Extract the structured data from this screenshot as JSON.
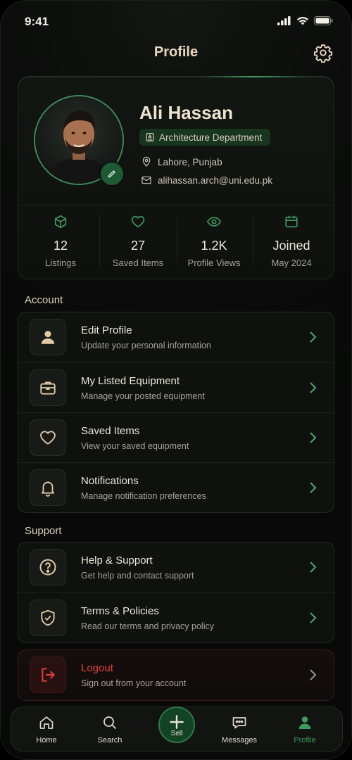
{
  "status_bar": {
    "time": "9:41"
  },
  "header": {
    "title": "Profile"
  },
  "profile": {
    "name": "Ali Hassan",
    "department": "Architecture Department",
    "location": "Lahore, Punjab",
    "email": "alihassan.arch@uni.edu.pk"
  },
  "stats": [
    {
      "icon": "cube-icon",
      "value": "12",
      "label": "Listings"
    },
    {
      "icon": "heart-icon",
      "value": "27",
      "label": "Saved Items"
    },
    {
      "icon": "eye-icon",
      "value": "1.2K",
      "label": "Profile Views"
    },
    {
      "icon": "calendar-icon",
      "value": "Joined",
      "label": "May 2024"
    }
  ],
  "account": {
    "title": "Account",
    "items": [
      {
        "icon": "user-icon",
        "title": "Edit Profile",
        "subtitle": "Update your personal information"
      },
      {
        "icon": "briefcase-icon",
        "title": "My Listed Equipment",
        "subtitle": "Manage your posted equipment"
      },
      {
        "icon": "heart-icon",
        "title": "Saved Items",
        "subtitle": "View your saved equipment"
      },
      {
        "icon": "bell-icon",
        "title": "Notifications",
        "subtitle": "Manage notification preferences"
      }
    ]
  },
  "support": {
    "title": "Support",
    "items": [
      {
        "icon": "question-icon",
        "title": "Help & Support",
        "subtitle": "Get help and contact support"
      },
      {
        "icon": "shield-check-icon",
        "title": "Terms & Policies",
        "subtitle": "Read our terms and privacy policy"
      }
    ]
  },
  "logout": {
    "title": "Logout",
    "subtitle": "Sign out from your account"
  },
  "tabs": [
    {
      "icon": "home-icon",
      "label": "Home"
    },
    {
      "icon": "search-icon",
      "label": "Search"
    },
    {
      "icon": "plus-icon",
      "label": "Sell"
    },
    {
      "icon": "message-icon",
      "label": "Messages"
    },
    {
      "icon": "profile-icon",
      "label": "Profile"
    }
  ],
  "colors": {
    "accent_green": "#3d8a55",
    "active_tab_green": "#3f9a5e",
    "logout_red": "#e0403c",
    "heading_beige": "#ead7bf"
  }
}
